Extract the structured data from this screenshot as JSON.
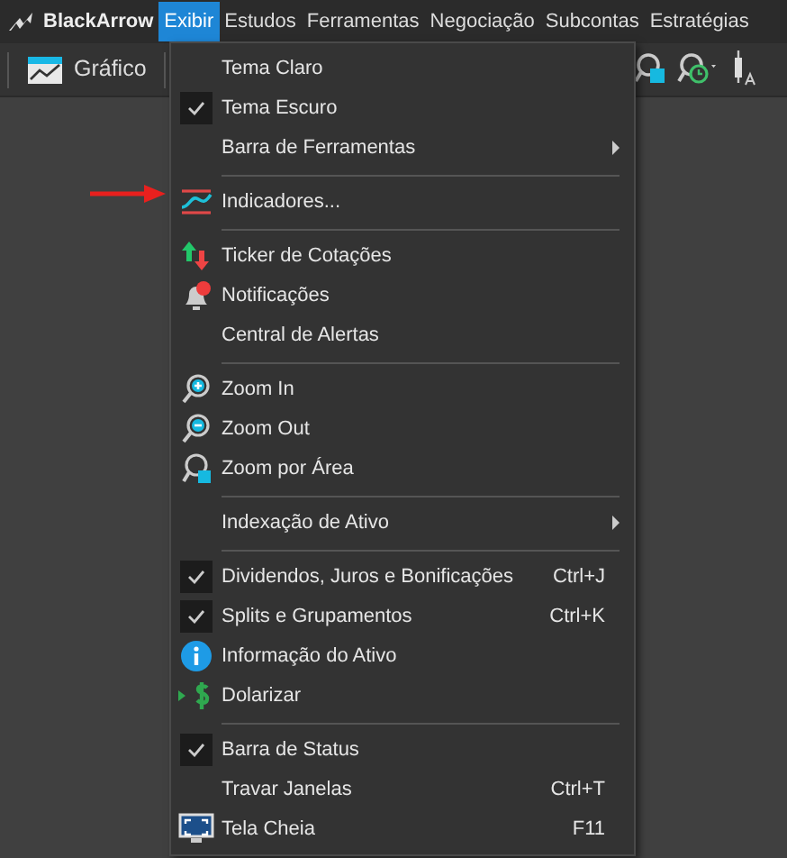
{
  "app": {
    "brand": "BlackArrow"
  },
  "menubar": [
    {
      "label": "Exibir",
      "selected": true
    },
    {
      "label": "Estudos",
      "selected": false
    },
    {
      "label": "Ferramentas",
      "selected": false
    },
    {
      "label": "Negociação",
      "selected": false
    },
    {
      "label": "Subcontas",
      "selected": false
    },
    {
      "label": "Estratégias",
      "selected": false
    }
  ],
  "toolbar": {
    "chart_button": "Gráfico"
  },
  "menu": [
    {
      "kind": "item",
      "label": "Tema Claro",
      "checked": false
    },
    {
      "kind": "item",
      "label": "Tema Escuro",
      "checked": true
    },
    {
      "kind": "item",
      "label": "Barra de Ferramentas",
      "checked": false,
      "submenu": true
    },
    {
      "kind": "separator"
    },
    {
      "kind": "item",
      "label": "Indicadores...",
      "checked": false
    },
    {
      "kind": "separator"
    },
    {
      "kind": "item",
      "label": "Ticker de Cotações",
      "checked": false
    },
    {
      "kind": "item",
      "label": "Notificações",
      "checked": false
    },
    {
      "kind": "item",
      "label": "Central de Alertas",
      "checked": false
    },
    {
      "kind": "separator"
    },
    {
      "kind": "item",
      "label": "Zoom In",
      "checked": false
    },
    {
      "kind": "item",
      "label": "Zoom Out",
      "checked": false
    },
    {
      "kind": "item",
      "label": "Zoom por Área",
      "checked": false
    },
    {
      "kind": "separator"
    },
    {
      "kind": "item",
      "label": "Indexação de Ativo",
      "checked": false,
      "submenu": true
    },
    {
      "kind": "separator"
    },
    {
      "kind": "item",
      "label": "Dividendos, Juros e Bonificações",
      "checked": true,
      "shortcut": "Ctrl+J"
    },
    {
      "kind": "item",
      "label": "Splits e Grupamentos",
      "checked": true,
      "shortcut": "Ctrl+K"
    },
    {
      "kind": "item",
      "label": "Informação do Ativo",
      "checked": false
    },
    {
      "kind": "item",
      "label": "Dolarizar",
      "checked": false
    },
    {
      "kind": "separator"
    },
    {
      "kind": "item",
      "label": "Barra de Status",
      "checked": true
    },
    {
      "kind": "item",
      "label": "Travar Janelas",
      "checked": false,
      "shortcut": "Ctrl+T"
    },
    {
      "kind": "item",
      "label": "Tela Cheia",
      "checked": false,
      "shortcut": "F11"
    }
  ]
}
